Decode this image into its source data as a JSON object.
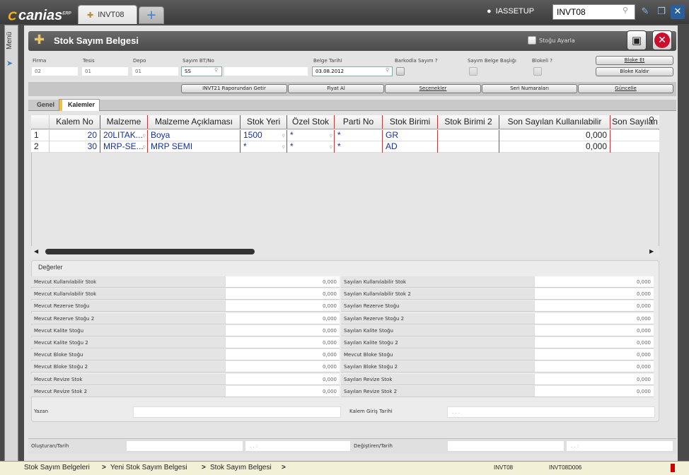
{
  "app": {
    "logo": "canias",
    "logo_sup": "ERP",
    "tab_label": "INVT08",
    "add_tab_label": "+",
    "user": "IASSETUP",
    "command_value": "INVT08",
    "menu_label": "Menü"
  },
  "form": {
    "title": "Stok Sayım Belgesi",
    "stock_adjust_label": "Stoğu Ayarla",
    "fields": {
      "firma_label": "Firma",
      "firma_value": "02",
      "tesis_label": "Tesis",
      "tesis_value": "01",
      "depo_label": "Depo",
      "depo_value": "01",
      "sayim_label": "Sayım BT/No",
      "sayim_value": "SS",
      "belge_tarihi_label": "Belge Tarihi",
      "belge_tarihi_value": "03.08.2012",
      "barkod_label": "Barkodla Sayım ?",
      "baslik_label": "Sayım Belge Başlığı",
      "blokeli_label": "Blokeli ?"
    },
    "buttons": {
      "bloke_et": "Bloke Et",
      "bloke_kaldir": "Bloke Kaldır",
      "invt21": "INVT21 Raporundan Getir",
      "fiyat_al": "Fiyat Al",
      "secenekler": "Seçenekler",
      "seri": "Seri Numaraları",
      "guncelle": "Güncelle"
    }
  },
  "tabs": {
    "genel": "Genel",
    "kalemler": "Kalemler"
  },
  "grid": {
    "columns": [
      "",
      "Kalem No",
      "Malzeme",
      "Malzeme Açıklaması",
      "Stok Yeri",
      "Özel Stok",
      "Parti No",
      "Stok Birimi",
      "Stok Birimi 2",
      "Son Sayılan Kullanılabilir",
      "Son Sayılan"
    ],
    "rows": [
      [
        "1",
        "20",
        "20LITAK...",
        "Boya",
        "1500",
        "*",
        "*",
        "GR",
        "",
        "0,000",
        ""
      ],
      [
        "2",
        "30",
        "MRP-SE...",
        "MRP SEMI",
        "*",
        "*",
        "*",
        "AD",
        "",
        "0,000",
        ""
      ]
    ]
  },
  "values": {
    "title": "Değerler",
    "left": [
      {
        "label": "Mevcut Kullanılabilir Stok",
        "value": "0,000"
      },
      {
        "label": "Mevcut Kullanılabilir Stok",
        "value": "0,000"
      },
      {
        "label": "Mevcut Rezerve Stoğu",
        "value": "0,000"
      },
      {
        "label": "Mevcut Rezerve Stoğu 2",
        "value": "0,000"
      },
      {
        "label": "Mevcut Kalite Stoğu",
        "value": "0,000"
      },
      {
        "label": "Mevcut Kalite Stoğu 2",
        "value": "0,000"
      },
      {
        "label": "Mevcut Bloke Stoğu",
        "value": "0,000"
      },
      {
        "label": "Mevcut Bloke Stoğu 2",
        "value": "0,000"
      },
      {
        "label": "Mevcut Revize Stok",
        "value": "0,000"
      },
      {
        "label": "Mevcut Revize Stok 2",
        "value": "0,000"
      }
    ],
    "right": [
      {
        "label": "Sayılan Kullanılabilir Stok",
        "value": "0,000"
      },
      {
        "label": "Sayılan Kullanılabilir Stok 2",
        "value": "0,000"
      },
      {
        "label": "Sayılan Rezerve Stoğu",
        "value": "0,000"
      },
      {
        "label": "Sayılan Rezerve Stoğu 2",
        "value": "0,000"
      },
      {
        "label": "Sayılan Kalite Stoğu",
        "value": "0,000"
      },
      {
        "label": "Sayılan Kalite Stoğu 2",
        "value": "0,000"
      },
      {
        "label": "Mevcut Bloke Stoğu",
        "value": "0,000"
      },
      {
        "label": "Sayılan Bloke Stoğu 2",
        "value": "0,000"
      },
      {
        "label": "Sayılan Revize Stok",
        "value": "0,000"
      },
      {
        "label": "Sayılan Revize Stok 2",
        "value": "0,000"
      }
    ],
    "yazan_label": "Yazan",
    "kalem_giris_label": "Kalem Giriş Tarihi",
    "kalem_giris_value": ". . ."
  },
  "footer": {
    "olusturan_label": "Oluşturan/Tarih",
    "olusturan_time": ". .   :",
    "degistiren_label": "Değiştiren/Tarih",
    "degistiren_time": ". .   :"
  },
  "status": {
    "crumbs": [
      "Stok Sayım Belgeleri",
      "Yeni Stok Sayım Belgesi",
      "Stok Sayım Belgesi"
    ],
    "separator": ">",
    "app_code": "INVT08",
    "form_code": "INVT08D006"
  }
}
